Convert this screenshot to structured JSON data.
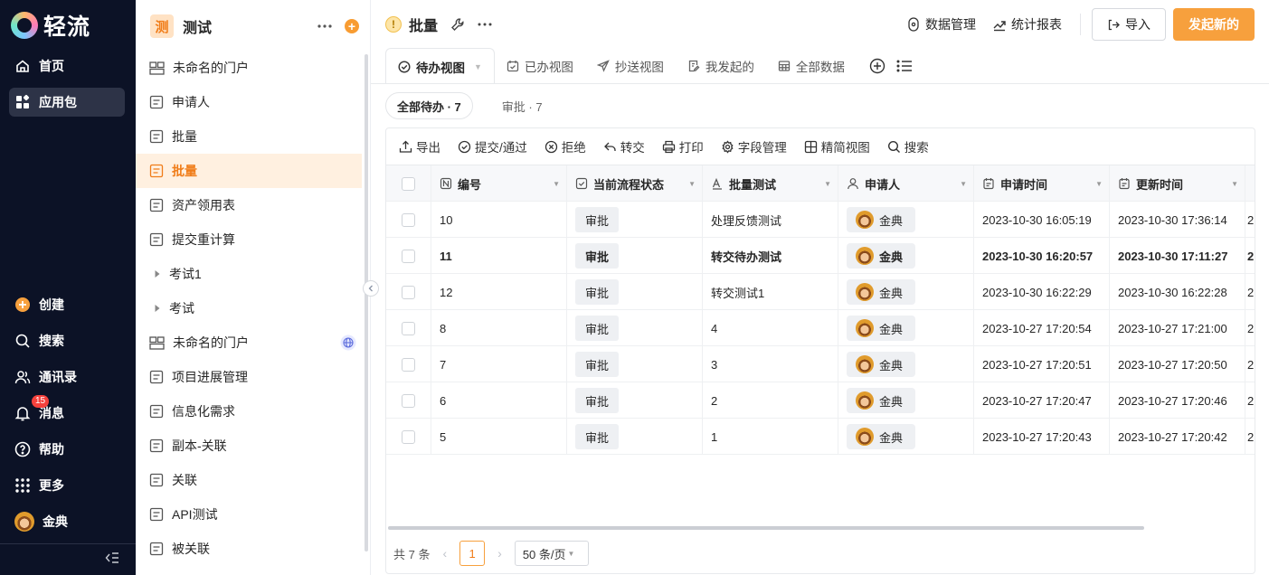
{
  "brand": {
    "name": "轻流"
  },
  "nav": {
    "top": [
      {
        "label": "首页",
        "icon": "home-icon"
      },
      {
        "label": "应用包",
        "icon": "apps-icon",
        "active": true
      }
    ],
    "bottom": [
      {
        "label": "创建",
        "icon": "plus-circle-icon"
      },
      {
        "label": "搜索",
        "icon": "search-icon"
      },
      {
        "label": "通讯录",
        "icon": "contacts-icon"
      },
      {
        "label": "消息",
        "icon": "bell-icon",
        "badge": "15"
      },
      {
        "label": "帮助",
        "icon": "help-icon"
      },
      {
        "label": "更多",
        "icon": "grid-dots-icon"
      },
      {
        "label": "金典",
        "icon": "avatar"
      }
    ]
  },
  "sidebar": {
    "app_icon_text": "测",
    "app_name": "测试",
    "items": [
      {
        "label": "未命名的门户",
        "icon": "portal-icon"
      },
      {
        "label": "申请人",
        "icon": "form-icon"
      },
      {
        "label": "批量",
        "icon": "form-icon"
      },
      {
        "label": "批量",
        "icon": "form-icon",
        "active": true
      },
      {
        "label": "资产领用表",
        "icon": "form-icon"
      },
      {
        "label": "提交重计算",
        "icon": "form-icon"
      },
      {
        "label": "考试1",
        "icon": "caret-right-icon",
        "tree": true
      },
      {
        "label": "考试",
        "icon": "caret-right-icon",
        "tree": true
      },
      {
        "label": "未命名的门户",
        "icon": "portal-icon",
        "globe": true
      },
      {
        "label": "项目进展管理",
        "icon": "form-icon"
      },
      {
        "label": "信息化需求",
        "icon": "form-icon"
      },
      {
        "label": "副本-关联",
        "icon": "form-icon"
      },
      {
        "label": "关联",
        "icon": "form-icon"
      },
      {
        "label": "API测试",
        "icon": "form-icon"
      },
      {
        "label": "被关联",
        "icon": "form-icon"
      }
    ]
  },
  "header": {
    "title": "批量",
    "data_manage": "数据管理",
    "report": "统计报表",
    "import": "导入",
    "submit_new": "发起新的"
  },
  "tabs": [
    {
      "label": "待办视图",
      "icon": "check-circle-icon",
      "active": true
    },
    {
      "label": "已办视图",
      "icon": "calendar-check-icon"
    },
    {
      "label": "抄送视图",
      "icon": "send-icon"
    },
    {
      "label": "我发起的",
      "icon": "doc-edit-icon"
    },
    {
      "label": "全部数据",
      "icon": "table-icon"
    }
  ],
  "chips": [
    {
      "label": "全部待办 · 7",
      "active": true
    },
    {
      "label": "审批 · 7"
    }
  ],
  "toolbar": [
    {
      "label": "导出",
      "icon": "export-icon"
    },
    {
      "label": "提交/通过",
      "icon": "check-circle-icon"
    },
    {
      "label": "拒绝",
      "icon": "x-circle-icon"
    },
    {
      "label": "转交",
      "icon": "forward-icon"
    },
    {
      "label": "打印",
      "icon": "printer-icon"
    },
    {
      "label": "字段管理",
      "icon": "settings-icon"
    },
    {
      "label": "精简视图",
      "icon": "grid-icon"
    },
    {
      "label": "搜索",
      "icon": "search-icon"
    }
  ],
  "table": {
    "columns": [
      {
        "label": "编号",
        "icon": "number-icon"
      },
      {
        "label": "当前流程状态",
        "icon": "checkbox-icon"
      },
      {
        "label": "批量测试",
        "icon": "text-icon"
      },
      {
        "label": "申请人",
        "icon": "user-icon"
      },
      {
        "label": "申请时间",
        "icon": "calendar-icon"
      },
      {
        "label": "更新时间",
        "icon": "calendar-icon"
      }
    ],
    "rows": [
      {
        "id": "10",
        "status": "审批",
        "test": "处理反馈测试",
        "applicant": "金典",
        "applied": "2023-10-30 16:05:19",
        "updated": "2023-10-30 17:36:14",
        "more": "2"
      },
      {
        "id": "11",
        "status": "审批",
        "test": "转交待办测试",
        "applicant": "金典",
        "applied": "2023-10-30 16:20:57",
        "updated": "2023-10-30 17:11:27",
        "more": "2",
        "bold": true
      },
      {
        "id": "12",
        "status": "审批",
        "test": "转交测试1",
        "applicant": "金典",
        "applied": "2023-10-30 16:22:29",
        "updated": "2023-10-30 16:22:28",
        "more": "2"
      },
      {
        "id": "8",
        "status": "审批",
        "test": "4",
        "applicant": "金典",
        "applied": "2023-10-27 17:20:54",
        "updated": "2023-10-27 17:21:00",
        "more": "2"
      },
      {
        "id": "7",
        "status": "审批",
        "test": "3",
        "applicant": "金典",
        "applied": "2023-10-27 17:20:51",
        "updated": "2023-10-27 17:20:50",
        "more": "2"
      },
      {
        "id": "6",
        "status": "审批",
        "test": "2",
        "applicant": "金典",
        "applied": "2023-10-27 17:20:47",
        "updated": "2023-10-27 17:20:46",
        "more": "2"
      },
      {
        "id": "5",
        "status": "审批",
        "test": "1",
        "applicant": "金典",
        "applied": "2023-10-27 17:20:43",
        "updated": "2023-10-27 17:20:42",
        "more": "2"
      }
    ]
  },
  "pager": {
    "total": "共 7 条",
    "current": "1",
    "page_size": "50 条/页"
  },
  "colors": {
    "accent": "#f7a03d",
    "nav_bg": "#0c1226",
    "active_bg": "#fff0e0"
  }
}
